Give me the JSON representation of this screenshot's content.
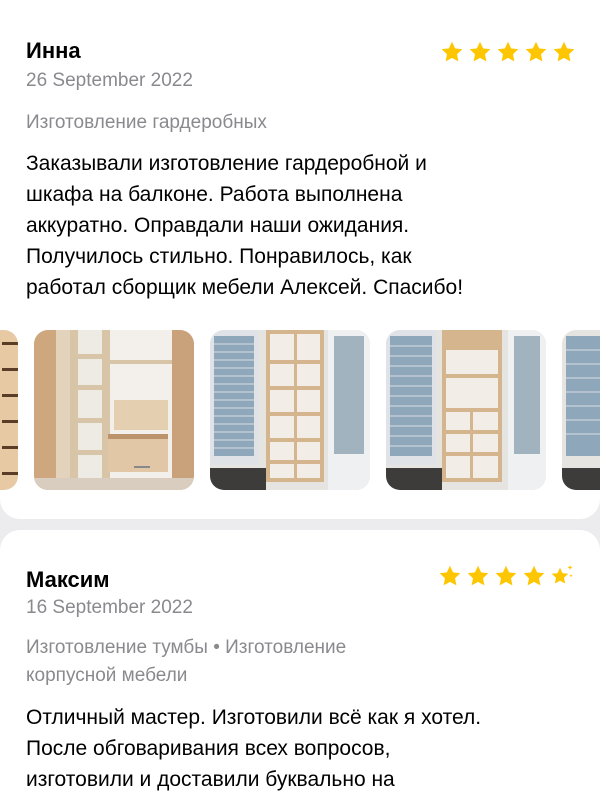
{
  "reviews": [
    {
      "author": "Инна",
      "date": "26 September 2022",
      "rating": 5,
      "services": [
        "Изготовление гардеробных"
      ],
      "text_lines": [
        "Заказывали изготовление гардеробной и",
        "шкафа на балконе. Работа выполнена",
        "аккуратно. Оправдали наши ожидания.",
        "Получилось стильно. Понравилось, как",
        "работал сборщик мебели Алексей. Спасибо!"
      ],
      "photos": [
        "wardrobe-photo-partial",
        "wardrobe-drawers-photo",
        "balcony-cabinet-photo-1",
        "balcony-cabinet-photo-2",
        "balcony-photo-partial"
      ]
    },
    {
      "author": "Максим",
      "date": "16 September 2022",
      "rating": 4.5,
      "services_line1": "Изготовление тумбы • Изготовление",
      "services_line2": "корпусной мебели",
      "text_lines": [
        "Отличный мастер. Изготовили всё как я хотел.",
        "После обговаривания всех вопросов,",
        "изготовили и доставили буквально на"
      ]
    }
  ],
  "colors": {
    "star": "#fdc600",
    "secondary_text": "#8a8a8e",
    "separator": "#ececee"
  }
}
